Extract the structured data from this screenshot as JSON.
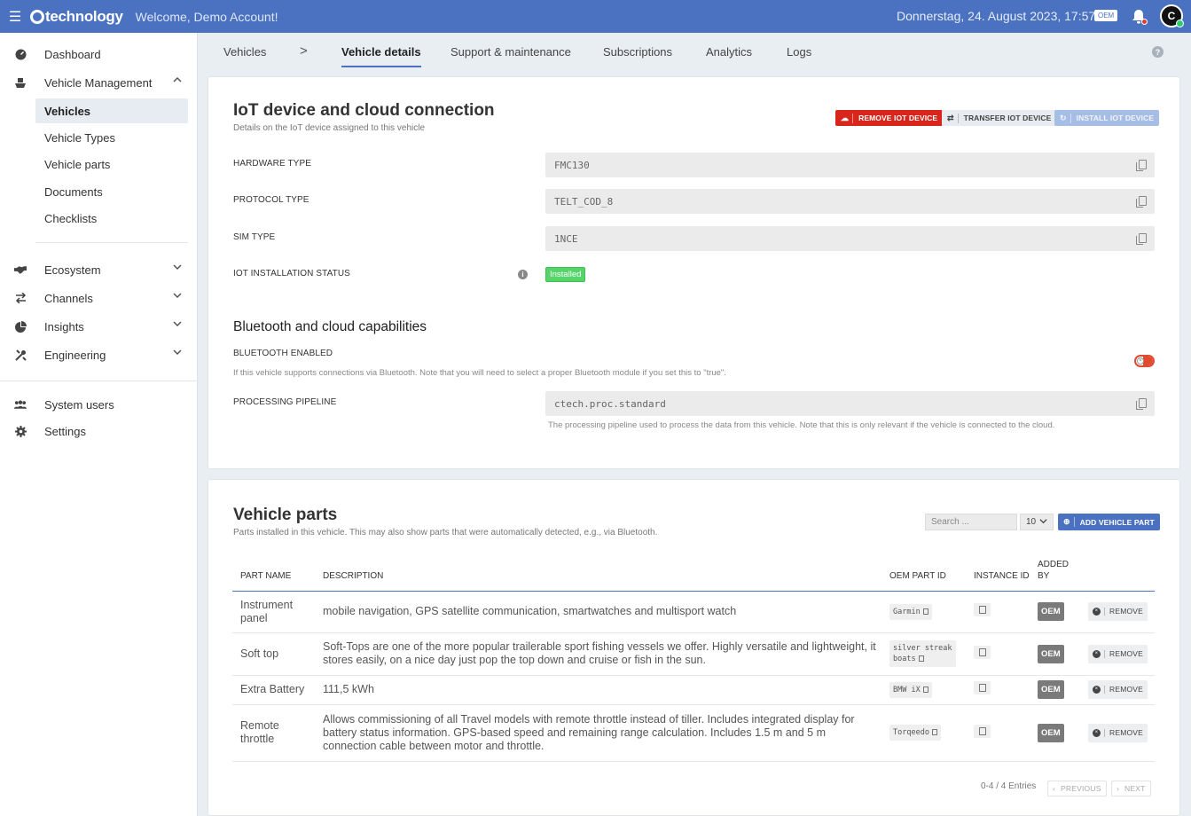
{
  "header": {
    "logo_text": "technology",
    "welcome": "Welcome, Demo Account!",
    "datetime": "Donnerstag, 24. August 2023, 17:57",
    "role_badge": "OEM",
    "avatar_initials": "C"
  },
  "sidebar": {
    "dashboard": "Dashboard",
    "vehicle_management": "Vehicle Management",
    "sub_items": [
      "Vehicles",
      "Vehicle Types",
      "Vehicle parts",
      "Documents",
      "Checklists"
    ],
    "ecosystem": "Ecosystem",
    "channels": "Channels",
    "insights": "Insights",
    "engineering": "Engineering",
    "system_users": "System users",
    "settings": "Settings"
  },
  "tabs": {
    "vehicles": "Vehicles",
    "separator": ">",
    "vehicle_details": "Vehicle details",
    "support": "Support & maintenance",
    "subscriptions": "Subscriptions",
    "analytics": "Analytics",
    "logs": "Logs",
    "help": "?"
  },
  "iot": {
    "title": "IoT device and cloud connection",
    "subtitle": "Details on the IoT device assigned to this vehicle",
    "remove_btn": "REMOVE IOT DEVICE",
    "transfer_btn": "TRANSFER IOT DEVICE",
    "install_btn": "INSTALL IOT DEVICE",
    "hardware_label": "HARDWARE TYPE",
    "hardware_value": "FMC130",
    "protocol_label": "PROTOCOL TYPE",
    "protocol_value": "TELT_COD_8",
    "sim_label": "SIM TYPE",
    "sim_value": "1NCE",
    "status_label": "IOT INSTALLATION STATUS",
    "status_value": "Installed"
  },
  "bluetooth": {
    "title": "Bluetooth and cloud capabilities",
    "enabled_label": "BLUETOOTH ENABLED",
    "enabled_help": "If this vehicle supports connections via Bluetooth. Note that you will need to select a proper Bluetooth module if you set this to \"true\".",
    "enabled_state": false,
    "pipeline_label": "PROCESSING PIPELINE",
    "pipeline_value": "ctech.proc.standard",
    "pipeline_help": "The processing pipeline used to process the data from this vehicle. Note that this is only relevant if the vehicle is connected to the cloud."
  },
  "parts": {
    "title": "Vehicle parts",
    "subtitle": "Parts installed in this vehicle. This may also show parts that were automatically detected, e.g., via Bluetooth.",
    "search_placeholder": "Search ...",
    "page_size": "10",
    "add_btn": "ADD VEHICLE PART",
    "columns": {
      "name": "PART NAME",
      "description": "DESCRIPTION",
      "oem_id": "OEM PART ID",
      "instance_id": "INSTANCE ID",
      "added_by": "ADDED BY"
    },
    "rows": [
      {
        "name": "Instrument panel",
        "description": "mobile navigation, GPS satellite communication, smartwatches and multisport watch",
        "oem_id": "Garmin",
        "added_by": "OEM",
        "remove": "REMOVE"
      },
      {
        "name": "Soft top",
        "description": "Soft-Tops are one of the more popular trailerable sport fishing vessels we offer. Highly versatile and lightweight, it stores easily, on a nice day just pop the top down and cruise or fish in the sun.",
        "oem_id": "silver streak boats",
        "added_by": "OEM",
        "remove": "REMOVE"
      },
      {
        "name": "Extra Battery",
        "description": "111,5 kWh",
        "oem_id": "BMW iX",
        "added_by": "OEM",
        "remove": "REMOVE"
      },
      {
        "name": "Remote throttle",
        "description": "Allows commissioning of all Travel models with remote throttle instead of tiller. Includes integrated display for battery status information. GPS-based speed and remaining range calculation. Includes 1.5 m and 5 m connection cable between motor and throttle.",
        "oem_id": "Torqeedo",
        "added_by": "OEM",
        "remove": "REMOVE"
      }
    ],
    "entries": "0-4 / 4 Entries",
    "prev": "PREVIOUS",
    "next": "NEXT"
  },
  "colors": {
    "accent": "#4a72c0",
    "danger": "#d9261c",
    "success": "#55d46a"
  }
}
